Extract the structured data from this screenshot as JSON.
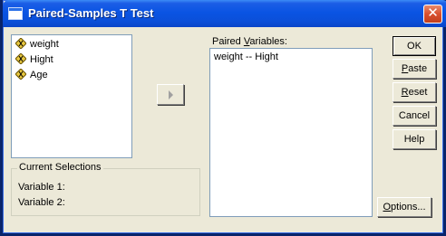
{
  "window": {
    "title": "Paired-Samples T Test",
    "close_label": "✕"
  },
  "variables": {
    "items": [
      {
        "label": "weight"
      },
      {
        "label": "Hight"
      },
      {
        "label": "Age"
      }
    ]
  },
  "paired": {
    "label_prefix": "Paired ",
    "label_mnemonic": "V",
    "label_suffix": "ariables:",
    "items": [
      "weight -- Hight"
    ]
  },
  "buttons": {
    "ok": "OK",
    "paste_m": "P",
    "paste_rest": "aste",
    "reset_m": "R",
    "reset_rest": "eset",
    "cancel": "Cancel",
    "help": "Help",
    "options_m": "O",
    "options_rest": "ptions..."
  },
  "current_selections": {
    "title": "Current Selections",
    "variable1": "Variable 1:",
    "variable2": "Variable 2:"
  }
}
